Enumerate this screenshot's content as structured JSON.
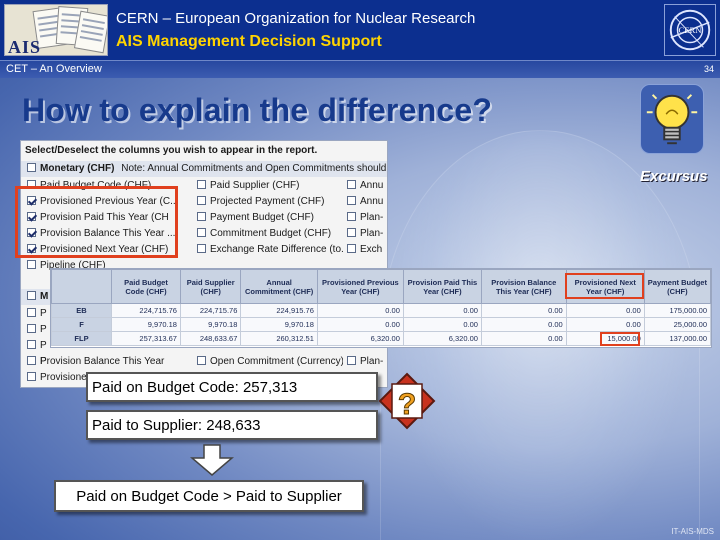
{
  "header": {
    "title1": "CERN – European Organization for Nuclear Research",
    "title2": "AIS Management Decision Support",
    "logo_text": "AIS"
  },
  "subbar": {
    "left": "CET – An Overview",
    "page": "34"
  },
  "slide_title": "How to explain the difference?",
  "excursus": "Excursus",
  "panel": {
    "title": "Select/Deselect the columns you wish to appear in the report.",
    "rows": [
      {
        "c1": "Monetary (CHF)",
        "c1_checked": false,
        "note": "Note: Annual Commitments and Open Commitments should not be summed"
      },
      {
        "c1": "Paid Budget Code (CHF)",
        "c1_checked": false,
        "c2": "Paid Supplier (CHF)",
        "c2_checked": false,
        "c3": "Annu",
        "c3_checked": false
      },
      {
        "c1": "Provisioned Previous Year (C...",
        "c1_checked": true,
        "c2": "Projected Payment (CHF)",
        "c2_checked": false,
        "c3": "Annu",
        "c3_checked": false
      },
      {
        "c1": "Provision Paid This Year (CH",
        "c1_checked": true,
        "c2": "Payment Budget (CHF)",
        "c2_checked": false,
        "c3": "Plan-",
        "c3_checked": false
      },
      {
        "c1": "Provision Balance This Year ...",
        "c1_checked": true,
        "c2": "Commitment Budget (CHF)",
        "c2_checked": false,
        "c3": "Plan-",
        "c3_checked": false
      },
      {
        "c1": "Provisioned Next Year (CHF)",
        "c1_checked": true,
        "c2": "Exchange Rate Difference (to...",
        "c2_checked": false,
        "c3": "Exch",
        "c3_checked": false
      },
      {
        "c1": "Pipeline (CHF)",
        "c1_checked": false
      },
      {
        "c1": "M",
        "c1_checked": false
      },
      {
        "c1": "P",
        "c1_checked": false
      },
      {
        "c1": "P",
        "c1_checked": false
      },
      {
        "c1": "P",
        "c1_checked": false
      },
      {
        "c1": "P",
        "c1_checked": false
      },
      {
        "c1": "Provision Balance This Year",
        "c1_checked": false,
        "c2": "Open Commitment (Currency)",
        "c2_checked": false,
        "c3": "Plan-",
        "c3_checked": false
      },
      {
        "c1": "Provisione",
        "c1_checked": false
      }
    ]
  },
  "report": {
    "headers": [
      "",
      "Paid Budget Code (CHF)",
      "Paid Supplier (CHF)",
      "Annual Commitment (CHF)",
      "Provisioned Previous Year (CHF)",
      "Provision Paid This Year (CHF)",
      "Provision Balance This Year (CHF)",
      "Provisioned Next Year (CHF)",
      "Payment Budget (CHF)"
    ],
    "rows": [
      [
        "EB",
        "224,715.76",
        "224,715.76",
        "224,915.76",
        "0.00",
        "0.00",
        "0.00",
        "0.00",
        "175,000.00"
      ],
      [
        "F",
        "9,970.18",
        "9,970.18",
        "9,970.18",
        "0.00",
        "0.00",
        "0.00",
        "0.00",
        "25,000.00"
      ],
      [
        "FLP",
        "257,313.67",
        "248,633.67",
        "260,312.51",
        "6,320.00",
        "6,320.00",
        "0.00",
        "15,000.00",
        "137,000.00"
      ]
    ]
  },
  "callouts": {
    "paid_budget": "Paid on Budget Code: 257,313",
    "paid_supplier": "Paid to Supplier: 248,633",
    "conclusion": "Paid on Budget Code > Paid to Supplier"
  },
  "footer": "IT-AIS-MDS",
  "colors": {
    "header_bg": "#0c2f8f",
    "title_yellow": "#ffd400",
    "highlight_red": "#e0401e",
    "slide_title": "#173a8c"
  }
}
